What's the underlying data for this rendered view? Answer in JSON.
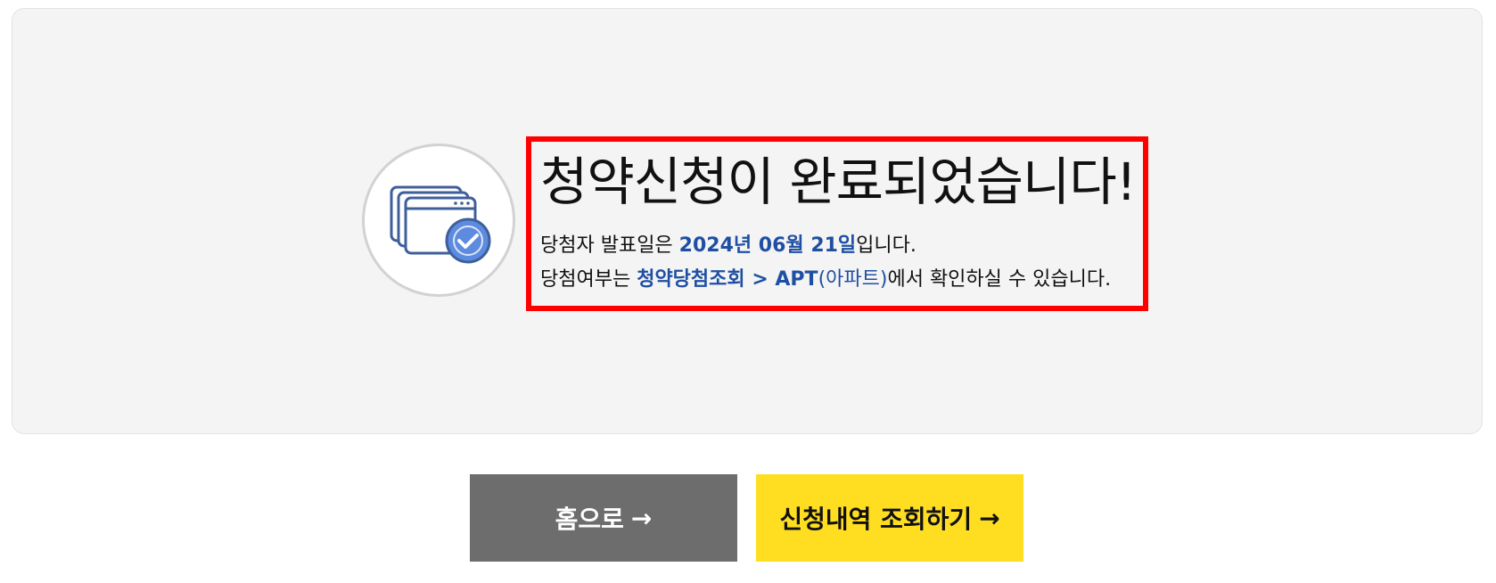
{
  "message": {
    "title": "청약신청이 완료되었습니다!",
    "line1_prefix": "당첨자 발표일은 ",
    "announce_date": "2024년 06월 21일",
    "line1_suffix": "입니다.",
    "line2_prefix": "당첨여부는 ",
    "link_menu": "청약당첨조회",
    "link_sep": " > APT",
    "link_sub": "(아파트)",
    "line2_suffix": "에서 확인하실 수 있습니다."
  },
  "icon": {
    "name": "browser-windows-check-icon",
    "stroke_color": "#3f5f9b",
    "check_fill": "#5d8be0"
  },
  "buttons": {
    "home_label": "홈으로",
    "history_label": "신청내역 조회하기",
    "arrow": "→"
  },
  "colors": {
    "highlight": "#1f4fa3",
    "border_highlight": "#ff0000",
    "home_bg": "#6d6d6d",
    "history_bg": "#ffde22"
  }
}
